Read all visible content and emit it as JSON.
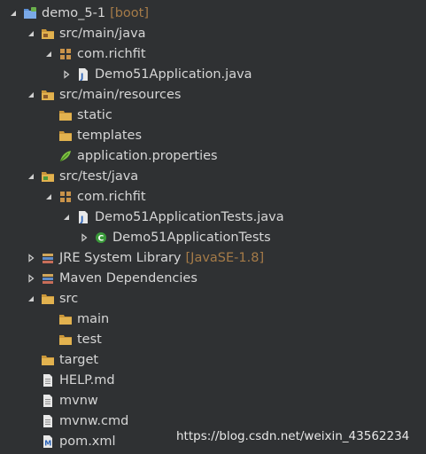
{
  "tree": [
    {
      "label": "demo_5-1",
      "decoration": "[boot]",
      "icon": "project-icon",
      "arrow": "expanded"
    },
    {
      "label": "src/main/java",
      "icon": "source-folder-icon",
      "arrow": "expanded"
    },
    {
      "label": "com.richfit",
      "icon": "package-icon",
      "arrow": "expanded"
    },
    {
      "label": "Demo51Application.java",
      "icon": "java-file-icon",
      "arrow": "collapsed"
    },
    {
      "label": "src/main/resources",
      "icon": "source-folder-icon",
      "arrow": "expanded"
    },
    {
      "label": "static",
      "icon": "folder-icon",
      "arrow": "none"
    },
    {
      "label": "templates",
      "icon": "folder-icon",
      "arrow": "none"
    },
    {
      "label": "application.properties",
      "icon": "properties-file-icon",
      "arrow": "none"
    },
    {
      "label": "src/test/java",
      "icon": "test-source-folder-icon",
      "arrow": "expanded"
    },
    {
      "label": "com.richfit",
      "icon": "package-icon",
      "arrow": "expanded"
    },
    {
      "label": "Demo51ApplicationTests.java",
      "icon": "java-file-icon",
      "arrow": "expanded"
    },
    {
      "label": "Demo51ApplicationTests",
      "icon": "class-icon",
      "arrow": "collapsed"
    },
    {
      "label": "JRE System Library",
      "decoration": "[JavaSE-1.8]",
      "icon": "library-icon",
      "arrow": "collapsed"
    },
    {
      "label": "Maven Dependencies",
      "icon": "library-icon",
      "arrow": "collapsed"
    },
    {
      "label": "src",
      "icon": "folder-icon",
      "arrow": "expanded"
    },
    {
      "label": "main",
      "icon": "folder-icon",
      "arrow": "none"
    },
    {
      "label": "test",
      "icon": "folder-icon",
      "arrow": "none"
    },
    {
      "label": "target",
      "icon": "folder-icon",
      "arrow": "none"
    },
    {
      "label": "HELP.md",
      "icon": "text-file-icon",
      "arrow": "none"
    },
    {
      "label": "mvnw",
      "icon": "text-file-icon",
      "arrow": "none"
    },
    {
      "label": "mvnw.cmd",
      "icon": "text-file-icon",
      "arrow": "none"
    },
    {
      "label": "pom.xml",
      "icon": "xml-file-icon",
      "arrow": "none"
    }
  ],
  "watermark": "https://blog.csdn.net/weixin_43562234",
  "colors": {
    "background": "#2f3133",
    "text": "#d6d6d6",
    "decoration": "#a57b48",
    "folder": "#d9a84a"
  }
}
